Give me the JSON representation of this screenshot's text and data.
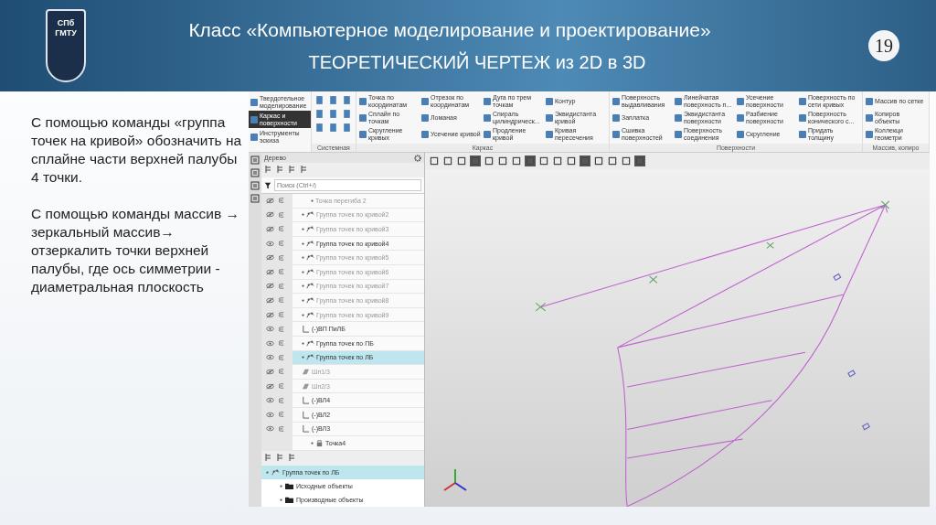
{
  "header": {
    "logo_lines": [
      "СПб",
      "ГМТУ"
    ],
    "title": "Класс «Компьютерное моделирование и проектирование»",
    "subtitle": "ТЕОРЕТИЧЕСКИЙ ЧЕРТЕЖ из 2D в 3D",
    "page_number": "19"
  },
  "paragraphs": [
    "С помощью команды «группа точек на кривой» обозначить на сплайне части верхней палубы 4 точки.",
    "С помощью команды массив → зеркальный массив→ отзеркалить точки верхней палубы, где ось симметрии - диаметральная плоскость"
  ],
  "ribbon": {
    "modes": [
      {
        "label": "Твердотельное моделирование",
        "selected": false
      },
      {
        "label": "Каркас и поверхности",
        "selected": true
      },
      {
        "label": "Инструменты эскиза",
        "selected": false
      }
    ],
    "system_label": "Системная",
    "groups": [
      {
        "label": "Каркас",
        "items": [
          "Точка по координатам",
          "Сплайн по точкам",
          "Скругление кривых",
          "Отрезок по координатам",
          "Ломаная",
          "Усечение кривой",
          "Дуга по трем точкам",
          "Спираль цилиндрическ...",
          "Продление кривой",
          "Контур",
          "Эквидистанта кривой",
          "Кривая пересечения"
        ]
      },
      {
        "label": "Поверхности",
        "items": [
          "Поверхность выдавливания",
          "Заплатка",
          "Сшивка поверхностей",
          "Линейчатая поверхность п...",
          "Эквидистанта поверхности",
          "Поверхность соединения",
          "Усечение поверхности",
          "Разбиение поверхности",
          "Скругление",
          "Поверхность по сети кривых",
          "Поверхность конического с...",
          "Придать толщину"
        ]
      },
      {
        "label": "Массив, копиро",
        "items": [
          "Массив по сетке",
          "Копиров объекты",
          "Коллекци геометри"
        ]
      }
    ]
  },
  "tree": {
    "title": "Дерево",
    "search_placeholder": "Поиск (Ctrl+/)",
    "rows": [
      {
        "label": "Точка перегиба 2",
        "kind": "point",
        "visible": false,
        "selected": false
      },
      {
        "label": "Группа точек по кривой2",
        "kind": "group",
        "visible": false,
        "selected": false
      },
      {
        "label": "Группа точек по кривой3",
        "kind": "group",
        "visible": false,
        "selected": false
      },
      {
        "label": "Группа точек по кривой4",
        "kind": "group",
        "visible": true,
        "selected": false
      },
      {
        "label": "Группа точек по кривой5",
        "kind": "group",
        "visible": false,
        "selected": false
      },
      {
        "label": "Группа точек по кривой6",
        "kind": "group",
        "visible": false,
        "selected": false
      },
      {
        "label": "Группа точек по кривой7",
        "kind": "group",
        "visible": false,
        "selected": false
      },
      {
        "label": "Группа точек по кривой8",
        "kind": "group",
        "visible": false,
        "selected": false
      },
      {
        "label": "Группа точек по кривой9",
        "kind": "group",
        "visible": false,
        "selected": false
      },
      {
        "label": "(-)ВП ПиЛБ",
        "kind": "sketch",
        "visible": true,
        "selected": false
      },
      {
        "label": "Группа точек по ПБ",
        "kind": "group",
        "visible": true,
        "selected": false
      },
      {
        "label": "Группа точек по ЛБ",
        "kind": "group",
        "visible": true,
        "selected": true
      },
      {
        "label": "Шп1/3",
        "kind": "surface",
        "visible": false,
        "selected": false
      },
      {
        "label": "Шп2/3",
        "kind": "surface",
        "visible": false,
        "selected": false
      },
      {
        "label": "(-)ВЛ4",
        "kind": "sketch",
        "visible": true,
        "selected": false
      },
      {
        "label": "(-)ВЛ2",
        "kind": "sketch",
        "visible": true,
        "selected": false
      },
      {
        "label": "(-)ВЛ3",
        "kind": "sketch",
        "visible": true,
        "selected": false
      },
      {
        "label": "Точка4",
        "kind": "locked",
        "selected": false
      }
    ]
  },
  "details": {
    "rows": [
      {
        "label": "Группа точек по ЛБ",
        "kind": "group",
        "selected": true
      },
      {
        "label": "Исходные объекты",
        "kind": "folder",
        "selected": false
      },
      {
        "label": "Производные объекты",
        "kind": "folder",
        "selected": false
      }
    ]
  }
}
